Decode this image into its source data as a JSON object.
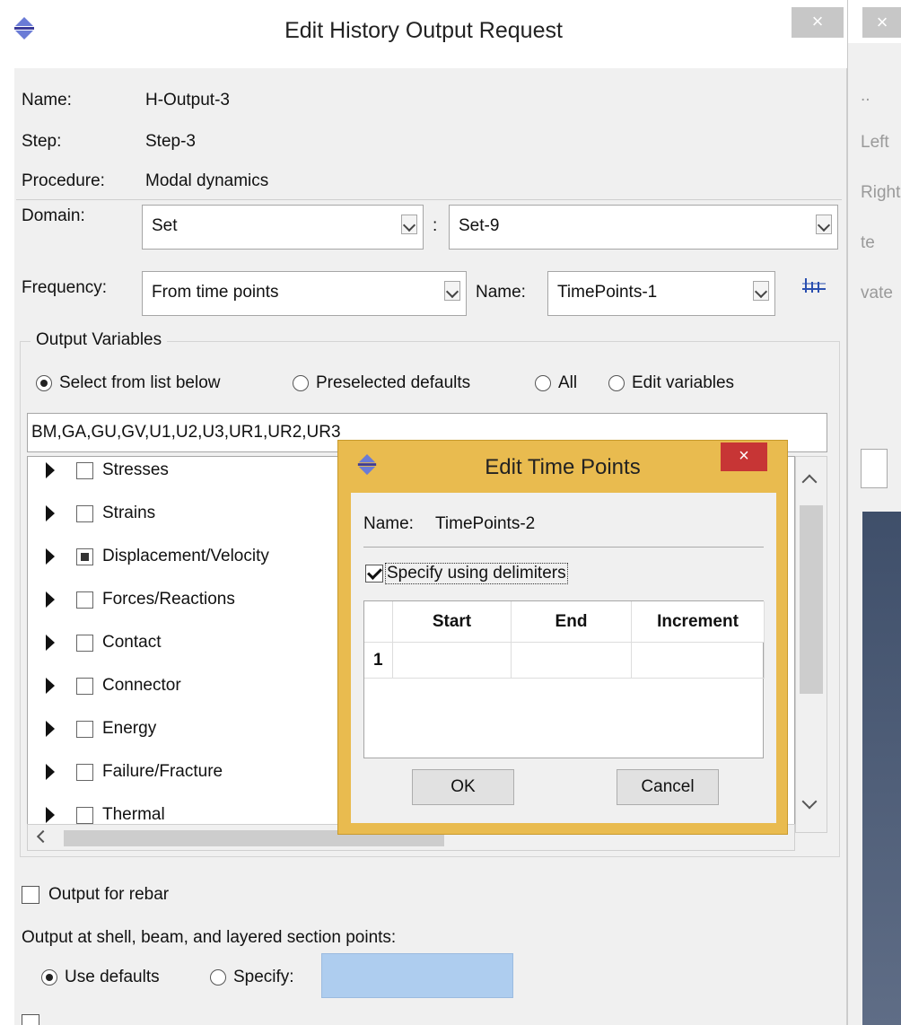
{
  "colors": {
    "popup_frame": "#e9bb4f",
    "popup_close": "#c73535",
    "specify_input": "#aecdef"
  },
  "main": {
    "title": "Edit History Output Request",
    "close_glyph": "×",
    "name_label": "Name:",
    "name_value": "H-Output-3",
    "step_label": "Step:",
    "step_value": "Step-3",
    "procedure_label": "Procedure:",
    "procedure_value": "Modal dynamics",
    "domain_label": "Domain:",
    "domain_value": "Set",
    "domain_sep": ":",
    "domain_set": "Set-9",
    "frequency_label": "Frequency:",
    "frequency_value": "From time points",
    "freq_name_label": "Name:",
    "freq_name_value": "TimePoints-1",
    "output_vars_title": "Output Variables",
    "radios": [
      "Select from list below",
      "Preselected defaults",
      "All",
      "Edit variables"
    ],
    "variables_text": "BM,GA,GU,GV,U1,U2,U3,UR1,UR2,UR3",
    "tree_items": [
      "Stresses",
      "Strains",
      "Displacement/Velocity",
      "Forces/Reactions",
      "Contact",
      "Connector",
      "Energy",
      "Failure/Fracture",
      "Thermal"
    ],
    "rebar_label": "Output for rebar",
    "section_points_label": "Output at shell, beam, and layered section points:",
    "use_defaults_label": "Use defaults",
    "specify_label": "Specify:"
  },
  "background_window": {
    "close_glyph": "×",
    "items": [
      "..",
      "Left",
      "Right",
      "te",
      "vate"
    ]
  },
  "popup": {
    "title": "Edit Time Points",
    "close_glyph": "×",
    "name_label": "Name:",
    "name_value": "TimePoints-2",
    "delimiters_label": "Specify using delimiters",
    "columns": [
      "Start",
      "End",
      "Increment"
    ],
    "row_number": "1",
    "ok_label": "OK",
    "cancel_label": "Cancel"
  }
}
